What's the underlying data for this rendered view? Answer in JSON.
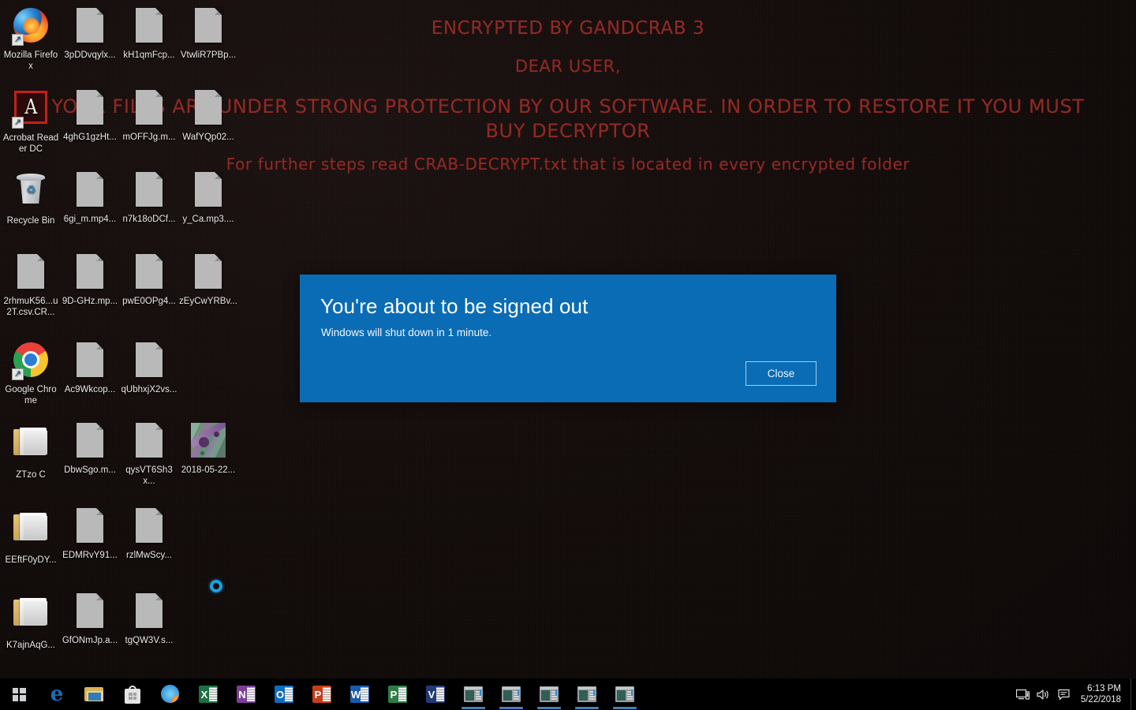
{
  "ransom_note": {
    "line1": "ENCRYPTED BY GANDCRAB 3",
    "line2": "DEAR USER,",
    "line3": "YOUR FILES ARE UNDER STRONG PROTECTION BY OUR SOFTWARE. IN ORDER TO RESTORE IT YOU MUST BUY DECRYPTOR",
    "line4": "For further steps read CRAB-DECRYPT.txt that is located in every encrypted folder",
    "text_color": "#8e2a25"
  },
  "desktop": {
    "background_color": "#140d0c",
    "icons": [
      {
        "label": "Mozilla Firefox",
        "type": "firefox",
        "shortcut": true,
        "col": 0,
        "row": 0
      },
      {
        "label": "3pDDvqylx...",
        "type": "document",
        "shortcut": false,
        "col": 1,
        "row": 0
      },
      {
        "label": "kH1qmFcp...",
        "type": "document",
        "shortcut": false,
        "col": 2,
        "row": 0
      },
      {
        "label": "VtwliR7PBp...",
        "type": "document",
        "shortcut": false,
        "col": 3,
        "row": 0
      },
      {
        "label": "Acrobat Reader DC",
        "type": "acrobat",
        "shortcut": true,
        "col": 0,
        "row": 1
      },
      {
        "label": "4ghG1gzHt...",
        "type": "document",
        "shortcut": false,
        "col": 1,
        "row": 1
      },
      {
        "label": "mOFFJg.m...",
        "type": "document",
        "shortcut": false,
        "col": 2,
        "row": 1
      },
      {
        "label": "WafYQp02...",
        "type": "document",
        "shortcut": false,
        "col": 3,
        "row": 1
      },
      {
        "label": "Recycle Bin",
        "type": "recyclebin",
        "shortcut": false,
        "col": 0,
        "row": 2
      },
      {
        "label": "6gi_m.mp4...",
        "type": "document",
        "shortcut": false,
        "col": 1,
        "row": 2
      },
      {
        "label": "n7k18oDCf...",
        "type": "document",
        "shortcut": false,
        "col": 2,
        "row": 2
      },
      {
        "label": "y_Ca.mp3....",
        "type": "document",
        "shortcut": false,
        "col": 3,
        "row": 2
      },
      {
        "label": "2rhmuK56...u2T.csv.CR...",
        "type": "document",
        "shortcut": false,
        "col": 0,
        "row": 3
      },
      {
        "label": "9D-GHz.mp...",
        "type": "document",
        "shortcut": false,
        "col": 1,
        "row": 3
      },
      {
        "label": "pwE0OPg4...",
        "type": "document",
        "shortcut": false,
        "col": 2,
        "row": 3
      },
      {
        "label": "zEyCwYRBv...",
        "type": "document",
        "shortcut": false,
        "col": 3,
        "row": 3
      },
      {
        "label": "Google Chrome",
        "type": "chrome",
        "shortcut": true,
        "col": 0,
        "row": 4
      },
      {
        "label": "Ac9Wkcop...",
        "type": "document",
        "shortcut": false,
        "col": 1,
        "row": 4
      },
      {
        "label": "qUbhxjX2vs...",
        "type": "document",
        "shortcut": false,
        "col": 2,
        "row": 4
      },
      {
        "label": "ZTzo C",
        "type": "folder",
        "shortcut": false,
        "col": 0,
        "row": 5
      },
      {
        "label": "DbwSgo.m...",
        "type": "document",
        "shortcut": false,
        "col": 1,
        "row": 5
      },
      {
        "label": "qysVT6Sh3x...",
        "type": "document",
        "shortcut": false,
        "col": 2,
        "row": 5
      },
      {
        "label": "2018-05-22...",
        "type": "picture",
        "shortcut": false,
        "col": 3,
        "row": 5
      },
      {
        "label": "EEftF0yDY...",
        "type": "folder",
        "shortcut": false,
        "col": 0,
        "row": 6
      },
      {
        "label": "EDMRvY91...",
        "type": "document",
        "shortcut": false,
        "col": 1,
        "row": 6
      },
      {
        "label": "rzlMwScy...",
        "type": "document",
        "shortcut": false,
        "col": 2,
        "row": 6
      },
      {
        "label": "K7ajnAqG...",
        "type": "folder",
        "shortcut": false,
        "col": 0,
        "row": 7
      },
      {
        "label": "GfONmJp.a...",
        "type": "document",
        "shortcut": false,
        "col": 1,
        "row": 7
      },
      {
        "label": "tgQW3V.s...",
        "type": "document",
        "shortcut": false,
        "col": 2,
        "row": 7
      }
    ]
  },
  "dialog": {
    "title": "You're about to be signed out",
    "message": "Windows will shut down in 1 minute.",
    "close_label": "Close",
    "accent_color": "#0a6cb5"
  },
  "taskbar": {
    "background_color": "#000000",
    "start_icon": "windows-logo-icon",
    "items": [
      {
        "name": "edge",
        "icon": "edge-icon",
        "letter": "e",
        "color": "#1a6bb5",
        "running": false
      },
      {
        "name": "explorer",
        "icon": "file-explorer-icon",
        "letter": "",
        "color": "#d9b259",
        "running": false
      },
      {
        "name": "store",
        "icon": "microsoft-store-icon",
        "letter": "",
        "color": "#e4e4e4",
        "running": false
      },
      {
        "name": "firefox",
        "icon": "firefox-icon",
        "letter": "",
        "color": "#f05a24",
        "running": false
      },
      {
        "name": "excel",
        "icon": "excel-icon",
        "letter": "X",
        "color": "#1d6f42",
        "running": false
      },
      {
        "name": "onenote",
        "icon": "onenote-icon",
        "letter": "N",
        "color": "#7b3f98",
        "running": false
      },
      {
        "name": "outlook",
        "icon": "outlook-icon",
        "letter": "O",
        "color": "#0f6cbd",
        "running": false
      },
      {
        "name": "powerpoint",
        "icon": "powerpoint-icon",
        "letter": "P",
        "color": "#c43e1c",
        "running": false
      },
      {
        "name": "word",
        "icon": "word-icon",
        "letter": "W",
        "color": "#1b5aa8",
        "running": false
      },
      {
        "name": "project",
        "icon": "project-icon",
        "letter": "P",
        "color": "#2e7d46",
        "running": false
      },
      {
        "name": "visio",
        "icon": "visio-icon",
        "letter": "V",
        "color": "#223a75",
        "running": false
      },
      {
        "name": "window-1",
        "icon": "app-window-icon",
        "letter": "",
        "color": "#9aa0a4",
        "running": true
      },
      {
        "name": "window-2",
        "icon": "app-window-icon",
        "letter": "",
        "color": "#9aa0a4",
        "running": true
      },
      {
        "name": "window-3",
        "icon": "app-window-icon",
        "letter": "",
        "color": "#9aa0a4",
        "running": true
      },
      {
        "name": "window-4",
        "icon": "app-window-icon",
        "letter": "",
        "color": "#9aa0a4",
        "running": true
      },
      {
        "name": "window-5",
        "icon": "app-window-icon",
        "letter": "",
        "color": "#9aa0a4",
        "running": true
      }
    ],
    "tray": {
      "network_icon": "network-monitor-icon",
      "volume_icon": "speaker-icon",
      "action_center_icon": "action-center-icon",
      "time": "6:13 PM",
      "date": "5/22/2018"
    }
  },
  "cortana": {
    "icon": "cortana-ring-icon",
    "color": "#1ba1e2"
  }
}
